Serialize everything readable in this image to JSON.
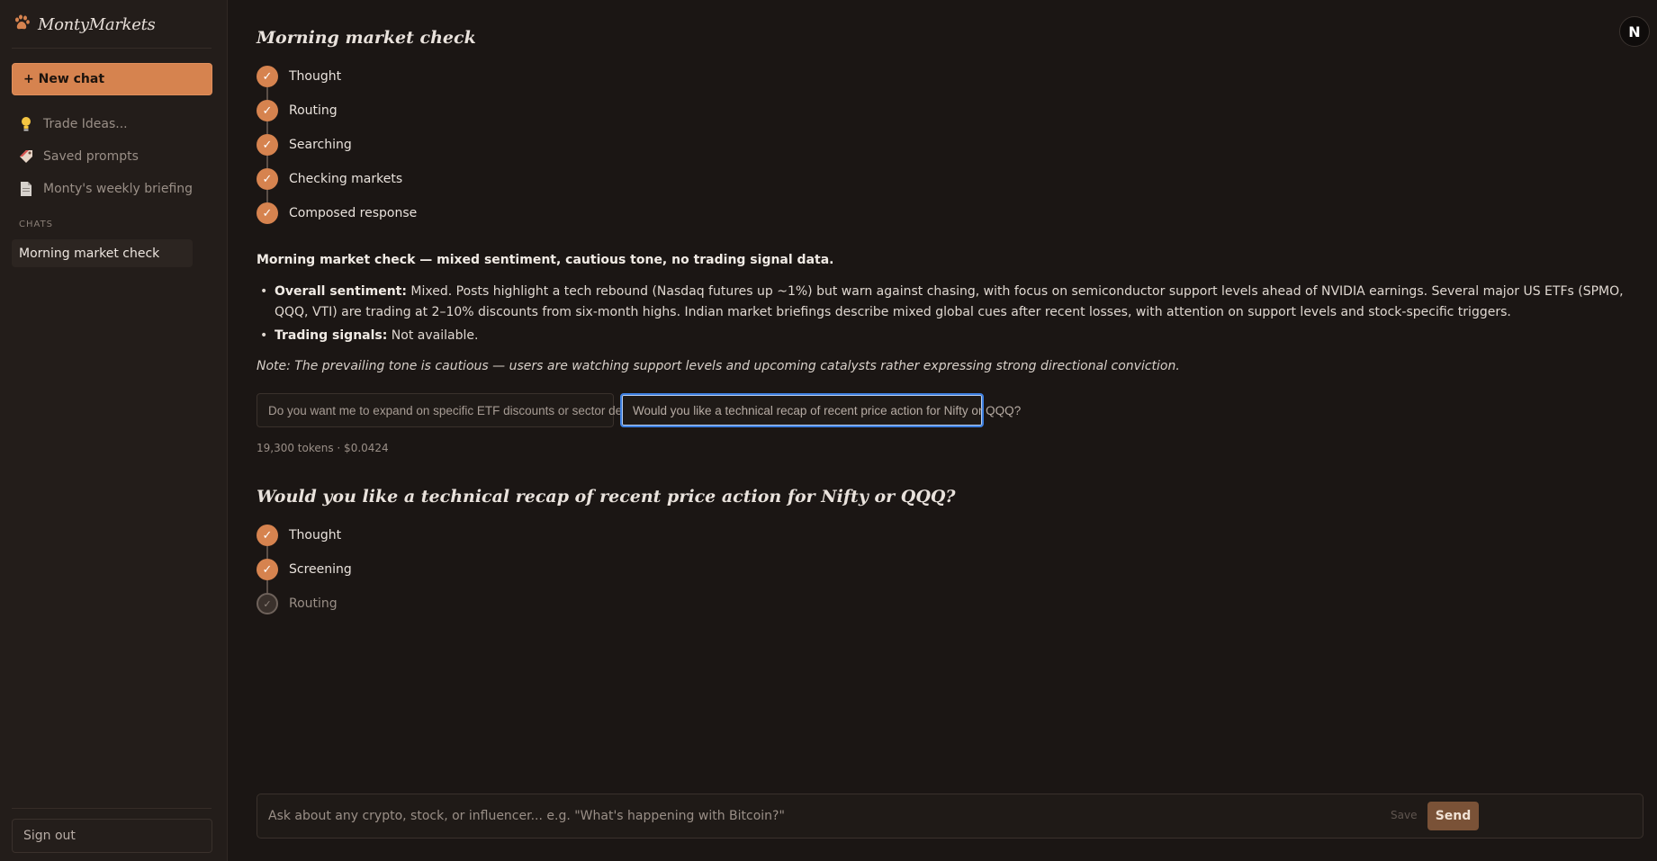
{
  "sidebar": {
    "brand": "MontyMarkets",
    "new_chat": "+ New chat",
    "nav": [
      {
        "label": "Trade Ideas...",
        "icon": "lightbulb-icon"
      },
      {
        "label": "Saved prompts",
        "icon": "tag-icon"
      },
      {
        "label": "Monty's weekly briefing",
        "icon": "document-icon"
      }
    ],
    "section_label": "CHATS",
    "chats": [
      {
        "label": "Morning market check"
      }
    ],
    "sign_out": "Sign out"
  },
  "header": {
    "avatar_letter": "N"
  },
  "thread": [
    {
      "question": "Morning market check",
      "steps": [
        {
          "label": "Thought",
          "status": "done"
        },
        {
          "label": "Routing",
          "status": "done"
        },
        {
          "label": "Searching",
          "status": "done"
        },
        {
          "label": "Checking markets",
          "status": "done"
        },
        {
          "label": "Composed response",
          "status": "done"
        }
      ]
    },
    {
      "question": "Would you like a technical recap of recent price action for Nifty or QQQ?",
      "steps": [
        {
          "label": "Thought",
          "status": "done"
        },
        {
          "label": "Screening",
          "status": "done"
        },
        {
          "label": "Routing",
          "status": "pending"
        }
      ]
    }
  ],
  "answer": {
    "headline": "Morning market check — mixed sentiment, cautious tone, no trading signal data.",
    "bullets": [
      {
        "label": "Overall sentiment:",
        "text": " Mixed. Posts highlight a tech rebound (Nasdaq futures up ~1%) but warn against chasing, with focus on semiconductor support levels ahead of NVIDIA earnings. Several major US ETFs (SPMO, QQQ, VTI) are trading at 2–10% discounts from six-month highs. Indian market briefings describe mixed global cues after recent losses, with attention on support levels and stock-specific triggers."
      },
      {
        "label": "Trading signals:",
        "text": " Not available."
      }
    ],
    "note": "Note: The prevailing tone is cautious — users are watching support levels and upcoming catalysts rather expressing strong directional conviction.",
    "suggestions": [
      "Do you want me to expand on specific ETF discounts or sector details?",
      "Would you like a technical recap of recent price action for Nifty or QQQ?"
    ],
    "meta": "19,300 tokens · $0.0424"
  },
  "composer": {
    "placeholder": "Ask about any crypto, stock, or influencer... e.g. \"What's happening with Bitcoin?\"",
    "save": "Save",
    "send": "Send"
  },
  "colors": {
    "accent": "#d6834f",
    "background": "#1b1614",
    "sidebar": "#231d1a",
    "focus": "#3d7fe0"
  }
}
